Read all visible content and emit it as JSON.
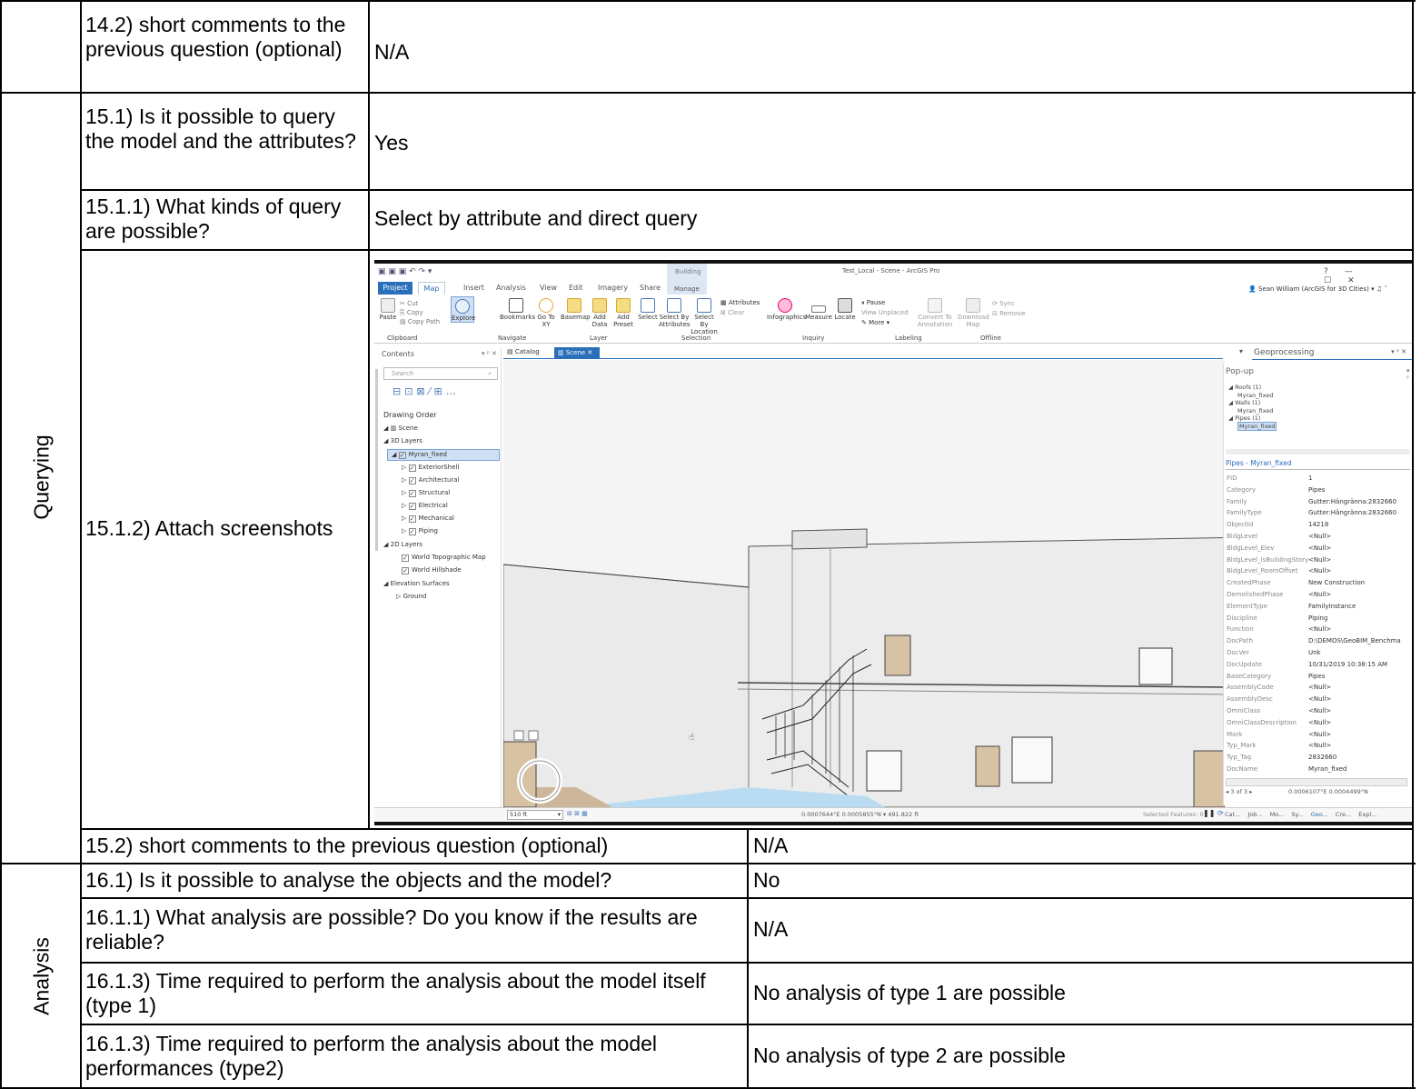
{
  "rows": {
    "r14_2": {
      "question": "14.2) short comments to the previous question (optional)",
      "answer": "N/A"
    },
    "querying_label": "Querying",
    "r15_1": {
      "question": "15.1) Is it possible to query the model and the attributes?",
      "answer": "Yes"
    },
    "r15_1_1": {
      "question": "15.1.1) What kinds of query are possible?",
      "answer": "Select by attribute and direct query"
    },
    "r15_1_2": {
      "question": "15.1.2) Attach screenshots"
    },
    "r15_2": {
      "question": "15.2) short comments to the previous question (optional)",
      "answer": "N/A"
    },
    "analysis_label": "Analysis",
    "r16_1": {
      "question": "16.1) Is it possible to analyse the objects and the model?",
      "answer": "No"
    },
    "r16_1_1": {
      "question": "16.1.1) What analysis are possible? Do you know if the results are reliable?",
      "answer": "N/A"
    },
    "r16_1_3a": {
      "question": "16.1.3) Time required to perform the analysis about the model itself (type 1)",
      "answer": "No analysis of type 1 are possible"
    },
    "r16_1_3b": {
      "question": "16.1.3) Time required to perform the analysis about the model performances (type2)",
      "answer": "No analysis of type 2 are possible"
    }
  },
  "screenshot": {
    "window_title": "Test_Local - Scene - ArcGIS Pro",
    "context_tab": "Building",
    "context_sub": "Manage",
    "user": "Sean William (ArcGIS for 3D Cities)",
    "window_controls": [
      "?",
      "—",
      "☐",
      "✕"
    ],
    "tabs": [
      "Project",
      "Map",
      "Insert",
      "Analysis",
      "View",
      "Edit",
      "Imagery",
      "Share"
    ],
    "ribbon": {
      "cut": "Cut",
      "copy": "Copy",
      "paste": "Paste",
      "copy_path": "Copy Path",
      "explore": "Explore",
      "bookmarks": "Bookmarks",
      "go_to_xy": "Go To XY",
      "basemap": "Basemap",
      "add_data": "Add Data",
      "add_preset": "Add Preset",
      "select": "Select",
      "select_by_attributes": "Select By Attributes",
      "select_by_location": "Select By Location",
      "attributes": "Attributes",
      "clear": "Clear",
      "infographics": "Infographics",
      "measure": "Measure",
      "locate": "Locate",
      "pause": "Pause",
      "view_unplaced": "View Unplaced",
      "more": "More",
      "convert_to_annotation": "Convert To Annotation",
      "download_map": "Download Map",
      "sync": "Sync",
      "remove": "Remove"
    },
    "groups": [
      "Clipboard",
      "Navigate",
      "Layer",
      "Selection",
      "Inquiry",
      "Labeling",
      "Offline"
    ],
    "contents": {
      "title": "Contents",
      "search_placeholder": "Search",
      "drawing_order": "Drawing Order",
      "tree": [
        "Scene",
        "3D Layers",
        "Myran_fixed",
        "ExteriorShell",
        "Architectural",
        "Structural",
        "Electrical",
        "Mechanical",
        "Piping",
        "2D Layers",
        "World Topographic Map",
        "World Hillshade",
        "Elevation Surfaces",
        "Ground"
      ]
    },
    "view_tabs": [
      "Catalog",
      "Scene"
    ],
    "geoprocessing": "Geoprocessing",
    "popup": {
      "title": "Pop-up",
      "tree": [
        "Roofs (1)",
        "Myran_fixed",
        "Walls (1)",
        "Myran_fixed",
        "Pipes (1)",
        "Myran_fixed"
      ],
      "header": "Pipes - Myran_fixed",
      "fields": [
        [
          "FID",
          "1"
        ],
        [
          "Category",
          "Pipes"
        ],
        [
          "Family",
          "Gutter:Hängränna:2832660"
        ],
        [
          "FamilyType",
          "Gutter:Hängränna:2832660"
        ],
        [
          "ObjectId",
          "14218"
        ],
        [
          "BldgLevel",
          "<Null>"
        ],
        [
          "BldgLevel_Elev",
          "<Null>"
        ],
        [
          "BldgLevel_IsBuildingStory",
          "<Null>"
        ],
        [
          "BldgLevel_RoomOffset",
          "<Null>"
        ],
        [
          "CreatedPhase",
          "New Construction"
        ],
        [
          "DemolishedPhase",
          "<Null>"
        ],
        [
          "ElementType",
          "FamilyInstance"
        ],
        [
          "Discipline",
          "Piping"
        ],
        [
          "Function",
          "<Null>"
        ],
        [
          "DocPath",
          "D:\\DEMOS\\GeoBIM_Benchma"
        ],
        [
          "DocVer",
          "Unk"
        ],
        [
          "DocUpdate",
          "10/31/2019 10:38:15 AM"
        ],
        [
          "BaseCategory",
          "Pipes"
        ],
        [
          "AssemblyCode",
          "<Null>"
        ],
        [
          "AssemblyDesc",
          "<Null>"
        ],
        [
          "OmniClass",
          "<Null>"
        ],
        [
          "OmniClassDescription",
          "<Null>"
        ],
        [
          "Mark",
          "<Null>"
        ],
        [
          "Typ_Mark",
          "<Null>"
        ],
        [
          "Typ_Tag",
          "2832660"
        ],
        [
          "DocName",
          "Myran_fixed"
        ]
      ],
      "nav": "3 of 3",
      "coords": "0.0006107°E 0.0004499°N"
    },
    "status": {
      "scale": "510 ft",
      "coords": "0.0007644°E 0.0005855°N",
      "elevation": "491.822 ft",
      "selected": "Selected Features: 0",
      "bottom_tabs": [
        "Cat...",
        "Job...",
        "Mo...",
        "Sy...",
        "Geo...",
        "Cre...",
        "Expl..."
      ]
    }
  }
}
